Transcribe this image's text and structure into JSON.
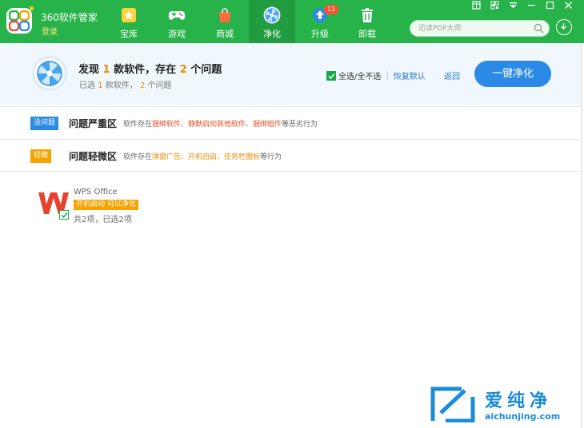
{
  "app": {
    "title": "360软件管家",
    "login": "登录"
  },
  "nav": [
    {
      "label": "宝库",
      "icon": "star-icon"
    },
    {
      "label": "游戏",
      "icon": "gamepad-icon"
    },
    {
      "label": "商城",
      "icon": "shopping-bag-icon"
    },
    {
      "label": "净化",
      "icon": "fan-icon",
      "active": true
    },
    {
      "label": "升级",
      "icon": "upgrade-arrow-icon",
      "badge": "13"
    },
    {
      "label": "卸载",
      "icon": "trash-icon"
    }
  ],
  "window_controls": [
    "skin-icon",
    "qrcode-icon",
    "menu-icon",
    "minimize-icon",
    "maximize-icon",
    "close-icon"
  ],
  "search": {
    "placeholder": "迅读PDF大师"
  },
  "summary": {
    "title_prefix": "发现",
    "software_count": "1",
    "title_mid": "款软件，存在",
    "issue_count": "2",
    "title_suffix": "个问题",
    "sub_prefix": "已选",
    "sub_software": "1",
    "sub_mid": "款软件，",
    "sub_issues": "2",
    "sub_suffix": "个问题",
    "select_all": "全选/全不选",
    "restore_default": "恢复默认",
    "return": "返回",
    "clean_button": "一键净化"
  },
  "sections": [
    {
      "tag": "没问题",
      "tag_color": "#2b8ae6",
      "title": "问题严重区",
      "desc_prefix": "软件存在",
      "desc_highlight": "捆绑软件、静默启动其他软件、捆绑组件",
      "desc_suffix": "等恶劣行为"
    },
    {
      "tag": "轻微",
      "tag_color": "#f6a300",
      "title": "问题轻微区",
      "desc_prefix": "软件存在",
      "desc_highlight": "弹窗广告、开机自启、任务栏图标",
      "desc_suffix": "等行为"
    }
  ],
  "software": {
    "name": "WPS Office",
    "badge": "开机启动 可以净化",
    "count": "共2项，已选2项"
  },
  "watermark": {
    "title": "爱纯净",
    "url": "aichunjing.com"
  },
  "colors": {
    "topbar": "#27b24a",
    "accent_blue": "#2b8ae6",
    "warn_orange": "#f08a00",
    "danger_red": "#e8502a"
  }
}
